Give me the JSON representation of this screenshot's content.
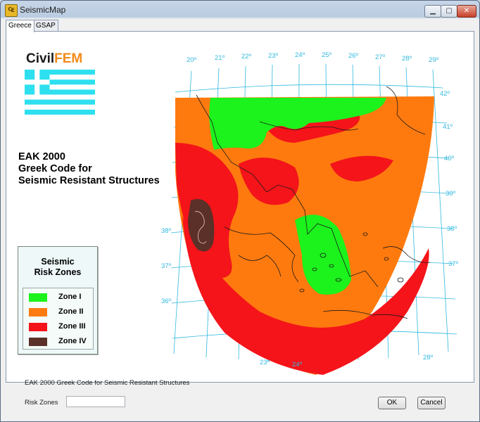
{
  "window": {
    "title": "SeismicMap",
    "app_icon": "civilfem-app-icon",
    "icon_glyph": "₠"
  },
  "window_controls": {
    "minimize": "▁",
    "maximize": "▢",
    "close": "✕"
  },
  "tabs": [
    {
      "label": "Greece",
      "active": true
    },
    {
      "label": "GSAP",
      "active": false
    }
  ],
  "logo": {
    "part1": "Civil",
    "part2": "FEM",
    "accent": "#f28a1a"
  },
  "code_title": {
    "line1": "EAK 2000",
    "line2": "Greek Code for",
    "line3": "Seismic Resistant Structures"
  },
  "legend": {
    "title_line1": "Seismic",
    "title_line2": "Risk Zones",
    "items": [
      {
        "label": "Zone I",
        "color": "#1cf21c"
      },
      {
        "label": "Zone II",
        "color": "#ff7a0e"
      },
      {
        "label": "Zone III",
        "color": "#f4141a"
      },
      {
        "label": "Zone IV",
        "color": "#5a3028"
      }
    ]
  },
  "map": {
    "grid_color": "#31b9e0",
    "top_labels": [
      "20º",
      "21º",
      "22º",
      "23º",
      "24º",
      "25º",
      "26º",
      "27º",
      "28º",
      "29º"
    ],
    "right_labels": [
      "42º",
      "41º",
      "40º",
      "39º",
      "38º",
      "37º"
    ],
    "left_labels": [
      "38º",
      "37º",
      "36º"
    ],
    "bottom_labels": [
      "23º",
      "24º",
      "28º"
    ]
  },
  "status_text": "EAK 2000 Greek Code for Seismic Resistant Structures",
  "risk_zones": {
    "label": "Risk Zones",
    "value": ""
  },
  "buttons": {
    "ok": "OK",
    "cancel": "Cancel"
  }
}
